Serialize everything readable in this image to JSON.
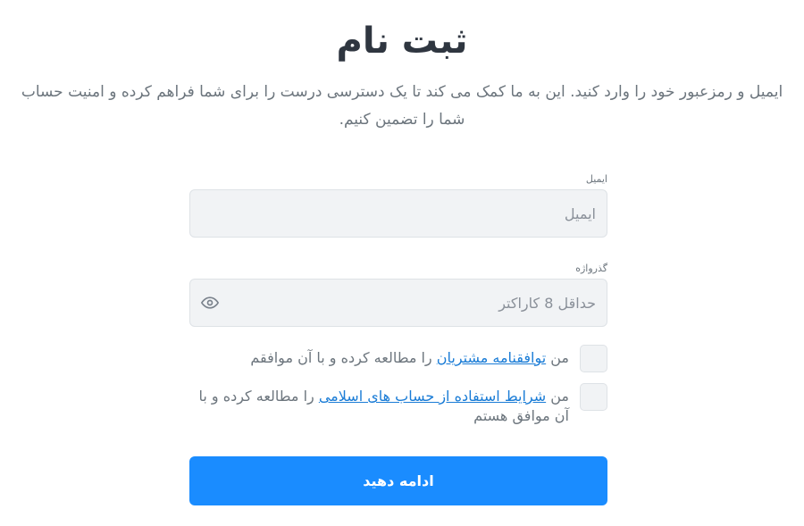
{
  "header": {
    "title": "ثبت نام",
    "subtitle": "ایمیل و رمزعبور خود را وارد کنید. این به ما کمک می کند تا یک دسترسی درست را برای شما فراهم کرده و امنیت حساب شما را تضمین کنیم."
  },
  "form": {
    "email": {
      "label": "ایمیل",
      "placeholder": "ایمیل",
      "value": ""
    },
    "password": {
      "label": "گذرواژه",
      "placeholder": "حداقل 8 کاراکتر",
      "value": "",
      "toggle_icon": "eye-icon"
    },
    "terms": {
      "prefix": "من ",
      "link": "توافقنامه مشتریان",
      "suffix": " را مطالعه کرده و با آن موافقم",
      "checked": false
    },
    "islamic_terms": {
      "prefix": "من ",
      "link": "شرایط استفاده از حساب های اسلامی",
      "suffix": " را مطالعه کرده و با آن موافق هستم",
      "checked": false
    },
    "submit_label": "ادامه دهید"
  },
  "colors": {
    "primary": "#1a8cff",
    "link": "#1a7cd6",
    "input_bg": "#f1f3f5",
    "muted_text": "#6c757d"
  }
}
